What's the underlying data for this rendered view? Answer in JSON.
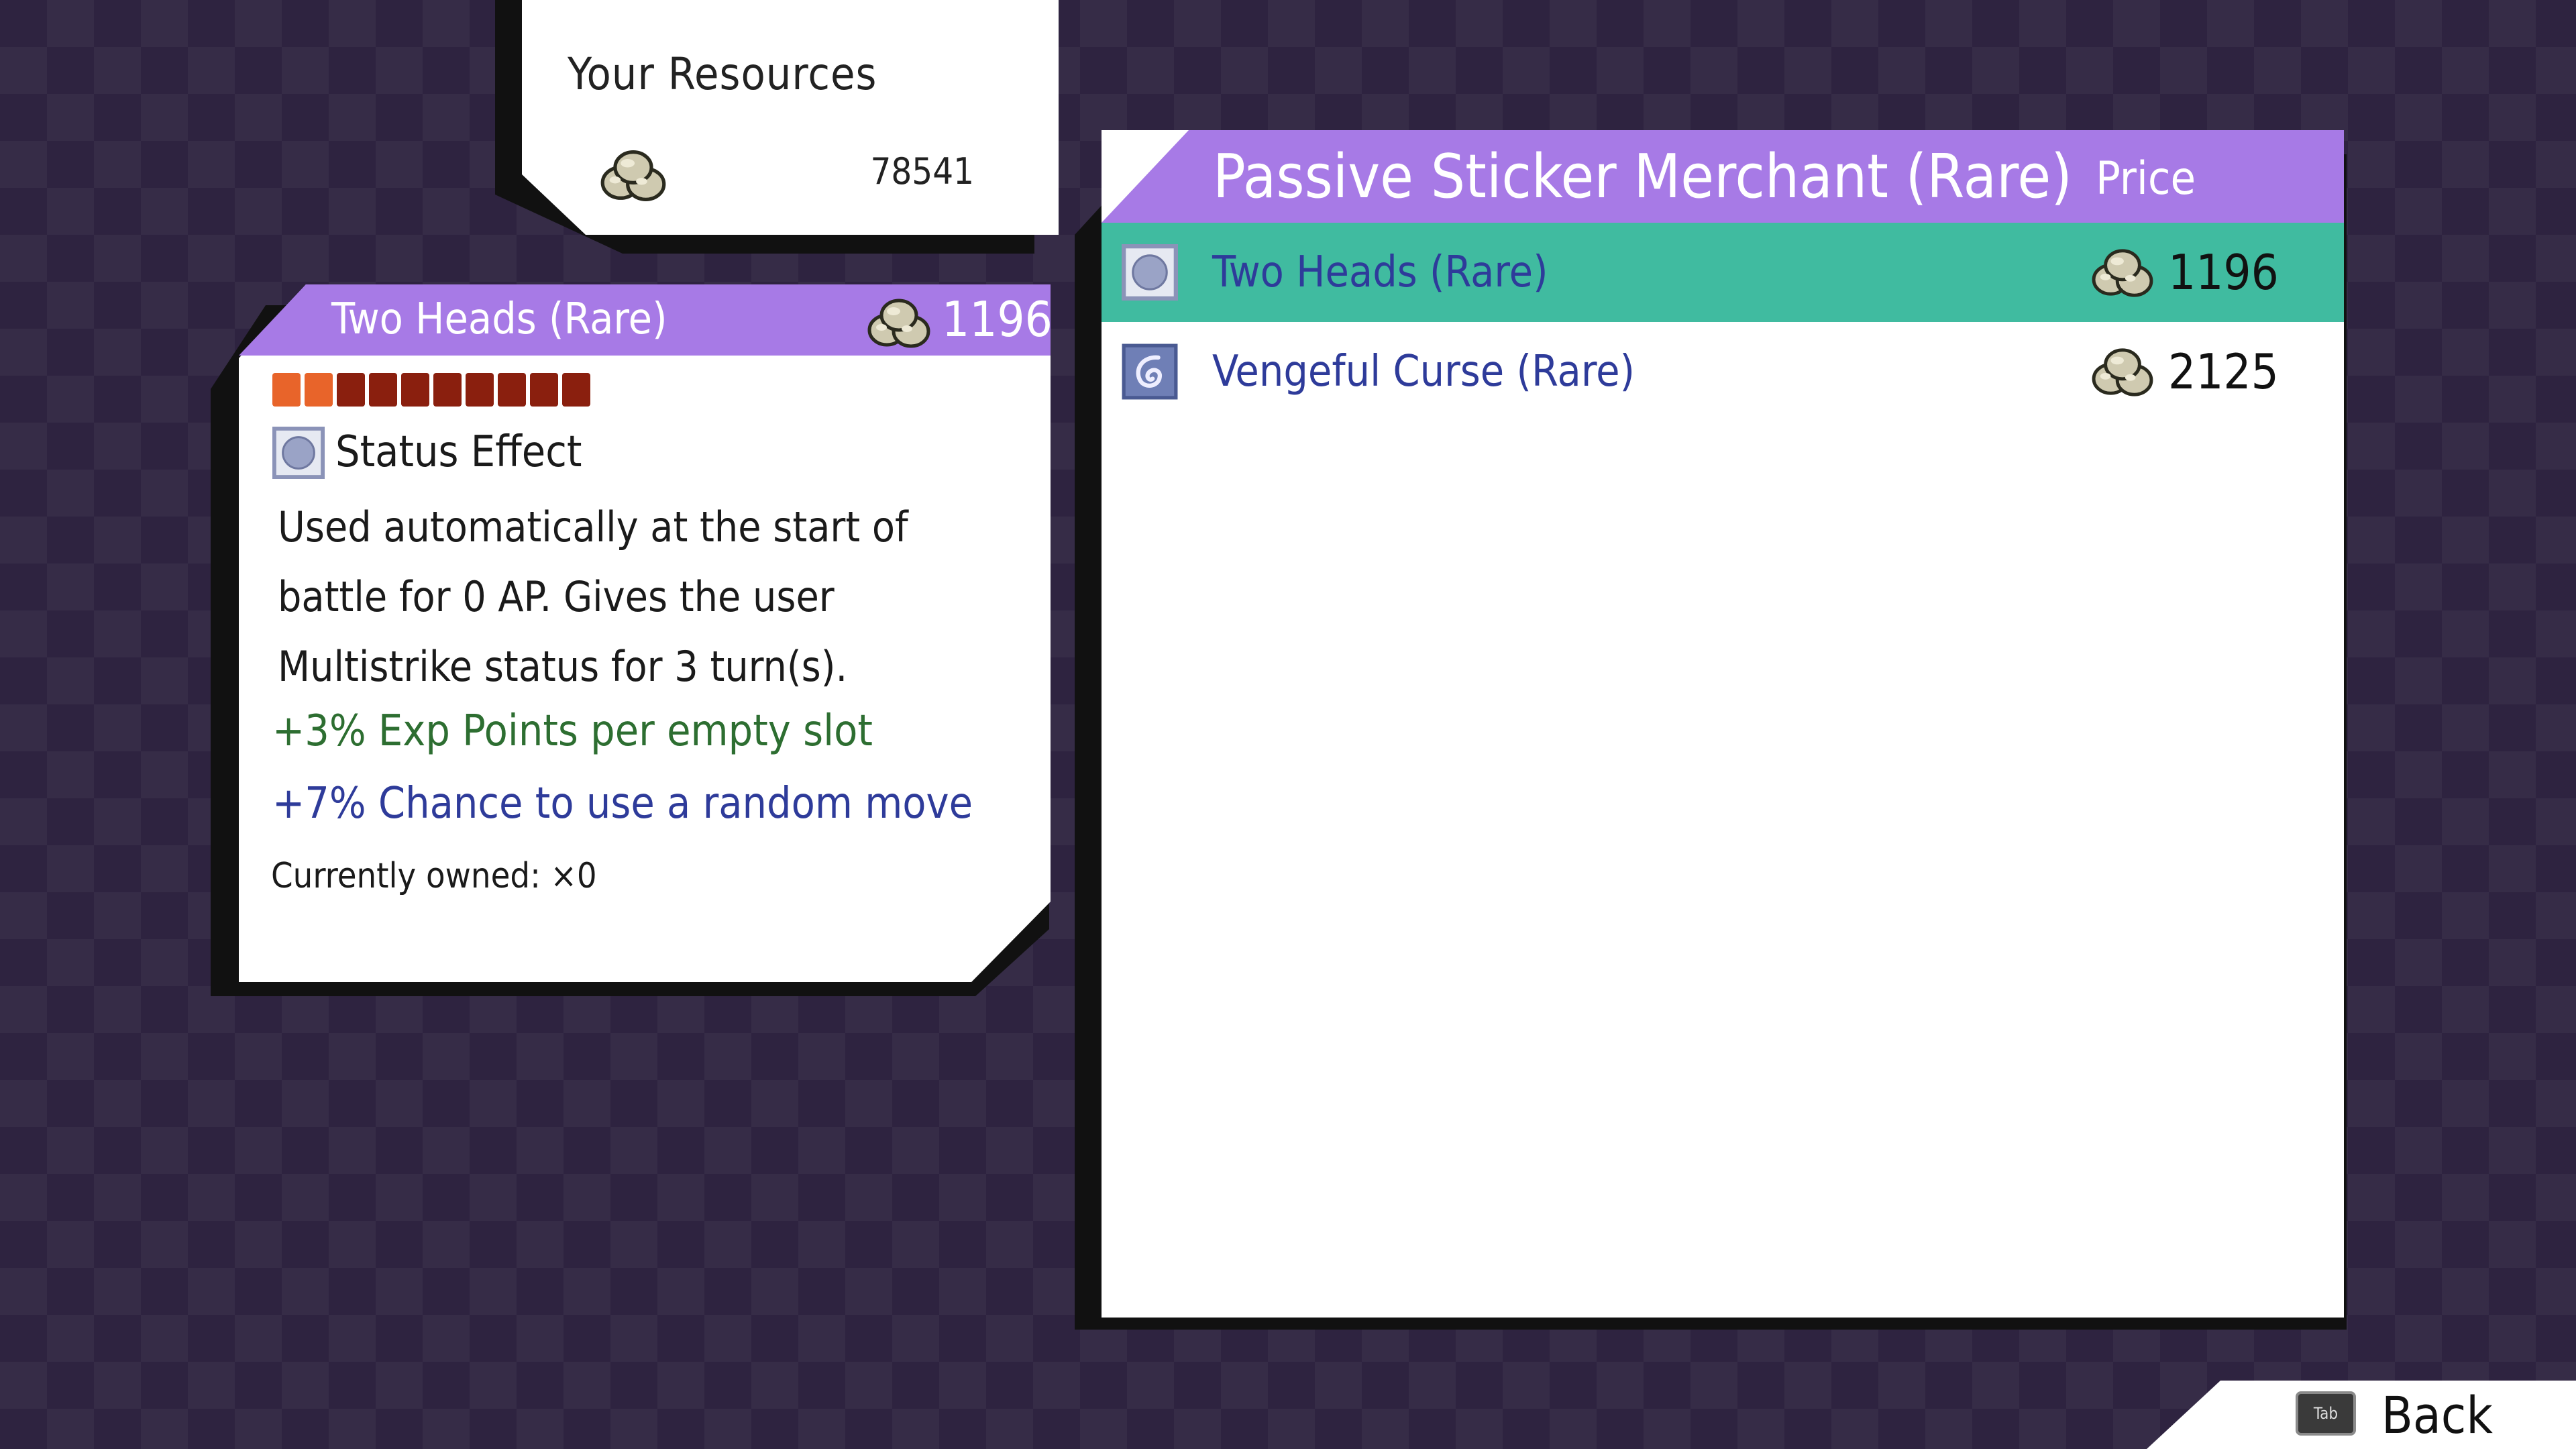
{
  "resources": {
    "title": "Your Resources",
    "coin_icon": "coin-pile-icon",
    "amount": "78541"
  },
  "detail": {
    "name": "Two Heads (Rare)",
    "price": "1196",
    "rarity_bar": {
      "filled": 2,
      "total": 10,
      "filled_color": "#e8642a",
      "empty_color": "#8a1f0e"
    },
    "status_icon": "status-effect-icon",
    "status_label": "Status Effect",
    "description": "Used automatically at the start of battle for 0 AP. Gives the user Multistrike status for 3 turn(s).",
    "bonus_exp": "+3% Exp Points per empty slot",
    "bonus_move": "+7% Chance to use a random move",
    "owned": "Currently owned: ×0"
  },
  "shop": {
    "title": "Passive Sticker Merchant (Rare)",
    "price_header": "Price",
    "items": [
      {
        "name": "Two Heads (Rare)",
        "price": "1196",
        "icon": "status-effect-icon",
        "selected": true
      },
      {
        "name": "Vengeful Curse (Rare)",
        "price": "2125",
        "icon": "curse-swirl-icon",
        "selected": false
      }
    ]
  },
  "back": {
    "key_label": "Tab",
    "label": "Back"
  },
  "colors": {
    "header_purple": "#a77ae6",
    "selected_teal": "#40bba0",
    "exp_green": "#2d6e31",
    "move_blue": "#2e3b9a"
  }
}
